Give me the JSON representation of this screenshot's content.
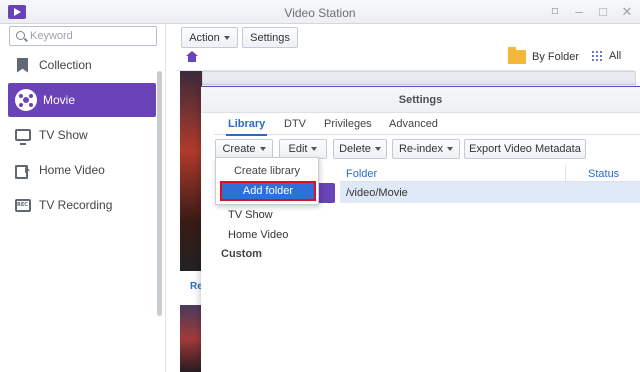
{
  "window": {
    "title": "Video Station",
    "controls": [
      "pin-icon",
      "minimize-icon",
      "maximize-icon",
      "close-icon"
    ]
  },
  "sidebar": {
    "search": {
      "placeholder": "Keyword",
      "value": ""
    },
    "items": [
      {
        "label": "Collection",
        "icon": "bookmark-icon",
        "active": false
      },
      {
        "label": "Movie",
        "icon": "film-reel-icon",
        "active": true
      },
      {
        "label": "TV Show",
        "icon": "tv-icon",
        "active": false
      },
      {
        "label": "Home Video",
        "icon": "camcorder-icon",
        "active": false
      },
      {
        "label": "TV Recording",
        "icon": "rec-icon",
        "active": false
      }
    ]
  },
  "toolbar": {
    "action_label": "Action",
    "settings_label": "Settings",
    "by_folder_label": "By Folder",
    "all_label": "All"
  },
  "content": {
    "link_label": "Re"
  },
  "dialog": {
    "title": "Settings",
    "tabs": [
      "Library",
      "DTV",
      "Privileges",
      "Advanced"
    ],
    "active_tab": "Library",
    "buttons": {
      "create": "Create",
      "edit": "Edit",
      "delete": "Delete",
      "reindex": "Re-index",
      "export": "Export Video Metadata"
    },
    "table": {
      "columns": [
        "Folder",
        "Status"
      ],
      "rows": [
        {
          "folder": "/video/Movie",
          "status": ""
        }
      ]
    },
    "library_list": [
      "TV Show",
      "Home Video"
    ],
    "custom_label": "Custom",
    "menu": {
      "items": [
        "Create library",
        "Add folder"
      ],
      "highlighted": "Add folder"
    }
  },
  "colors": {
    "accent": "#6b43b8",
    "link": "#2b6bc8",
    "menu_highlight": "#2f6fd8",
    "focus_border": "#e0101a",
    "folder": "#f4b73a"
  }
}
